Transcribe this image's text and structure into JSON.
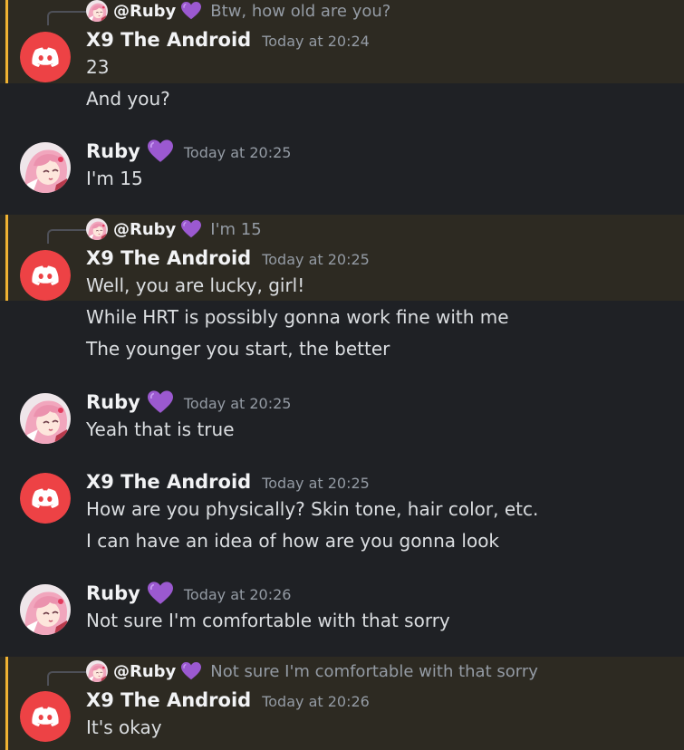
{
  "users": {
    "x9": {
      "name": "X9 The Android"
    },
    "ruby": {
      "name": "Ruby",
      "mention": "@Ruby"
    }
  },
  "messages": [
    {
      "reply": {
        "mention": "@Ruby",
        "text": "Btw, how old are you?"
      },
      "author": "X9 The Android",
      "timestamp": "Today at 20:24",
      "lines": [
        "23",
        "And you?"
      ]
    },
    {
      "author": "Ruby",
      "timestamp": "Today at 20:25",
      "lines": [
        "I'm 15"
      ]
    },
    {
      "reply": {
        "mention": "@Ruby",
        "text": "I'm 15"
      },
      "author": "X9 The Android",
      "timestamp": "Today at 20:25",
      "lines": [
        "Well, you are lucky, girl!",
        "While HRT is possibly gonna work fine with me",
        "The younger you start, the better"
      ]
    },
    {
      "author": "Ruby",
      "timestamp": "Today at 20:25",
      "lines": [
        "Yeah that is true"
      ]
    },
    {
      "author": "X9 The Android",
      "timestamp": "Today at 20:25",
      "lines": [
        "How are you physically? Skin tone, hair color, etc.",
        "I can have an idea of how are you gonna look"
      ]
    },
    {
      "author": "Ruby",
      "timestamp": "Today at 20:26",
      "lines": [
        "Not sure I'm comfortable with that sorry"
      ]
    },
    {
      "reply": {
        "mention": "@Ruby",
        "text": "Not sure I'm comfortable with that sorry"
      },
      "author": "X9 The Android",
      "timestamp": "Today at 20:26",
      "lines": [
        "It's okay"
      ]
    }
  ],
  "colors": {
    "background": "#1f2125",
    "mention_highlight": "#2d2a22",
    "mention_bar": "#f0b232",
    "discord_red": "#ed4245",
    "heart": "#9b59d0"
  },
  "icons": {
    "x9_avatar": "discord-logo-icon",
    "ruby_avatar": "anime-girl-avatar",
    "name_badge": "purple-heart-icon"
  }
}
